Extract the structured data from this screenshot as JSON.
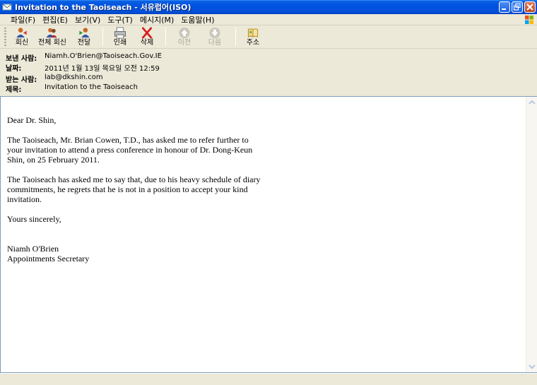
{
  "window": {
    "title": "Invitation to the Taoiseach - 서유럽어(ISO)"
  },
  "menu": [
    "파일(F)",
    "편집(E)",
    "보기(V)",
    "도구(T)",
    "메시지(M)",
    "도움말(H)"
  ],
  "toolbar": {
    "reply": "회신",
    "reply_all": "전체 회신",
    "forward": "전달",
    "print": "인쇄",
    "delete": "삭제",
    "previous": "이전",
    "next": "다음",
    "addresses": "주소"
  },
  "header": {
    "from_label": "보낸 사람:",
    "from_value": "Niamh.O'Brien@Taoiseach.Gov.IE",
    "date_label": "날짜:",
    "date_value": "2011년 1월 13일 목요일 오전 12:59",
    "to_label": "받는 사람:",
    "to_value": "lab@dkshin.com",
    "subject_label": "제목:",
    "subject_value": "Invitation to the Taoiseach"
  },
  "message": {
    "greeting": "Dear Dr. Shin,",
    "para1": "The Taoiseach, Mr. Brian Cowen, T.D., has asked me to refer further to your invitation to attend a press conference in honour of Dr. Dong-Keun Shin, on 25 February 2011.",
    "para2": "The Taoiseach has asked me to say that, due to his heavy schedule of diary commitments, he regrets that he is not in a position to accept your kind invitation.",
    "closing": "Yours sincerely,",
    "signature_name": "Niamh O'Brien",
    "signature_title": "Appointments Secretary"
  }
}
